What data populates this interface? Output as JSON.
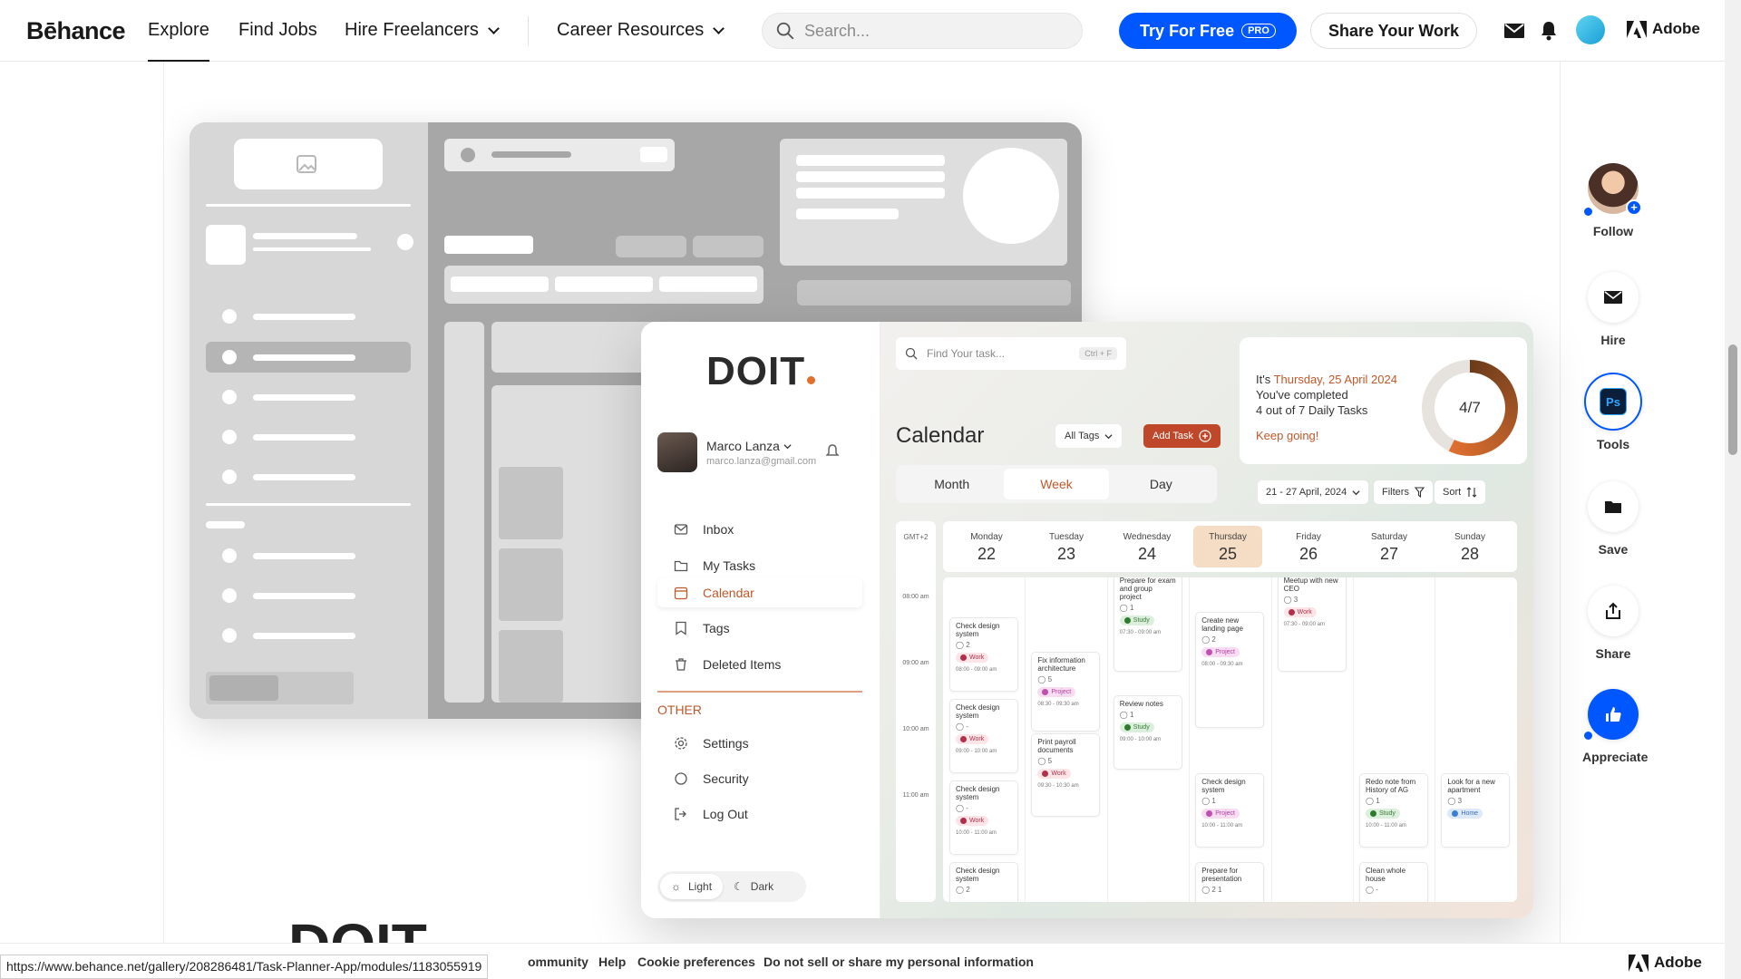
{
  "nav": {
    "logo": "Bēhance",
    "explore": "Explore",
    "find_jobs": "Find Jobs",
    "hire_freelancers": "Hire Freelancers",
    "career_resources": "Career Resources",
    "search_placeholder": "Search...",
    "try_free": "Try For Free",
    "pro_badge": "PRO",
    "share_work": "Share Your Work",
    "adobe": "Adobe"
  },
  "app": {
    "brand": "DOIT",
    "user_name": "Marco Lanza",
    "user_email": "marco.lanza@gmail.com",
    "menu": [
      "Inbox",
      "My Tasks",
      "Calendar",
      "Tags",
      "Deleted Items"
    ],
    "other_label": "OTHER",
    "other_menu": [
      "Settings",
      "Security",
      "Log Out"
    ],
    "theme_light": "Light",
    "theme_dark": "Dark",
    "search_placeholder": "Find Your task...",
    "search_shortcut": "Ctrl + F",
    "calendar_title": "Calendar",
    "all_tags": "All Tags",
    "add_task": "Add Task",
    "summary_prefix": "It's ",
    "summary_date": "Thursday, 25 April 2024",
    "summary_line2": "You've completed",
    "summary_line3": "4 out of 7 Daily Tasks",
    "keep_going": "Keep going!",
    "progress_label": "4/7",
    "progress_fraction": 0.571,
    "view_tabs": [
      "Month",
      "Week",
      "Day"
    ],
    "date_range": "21 - 27 April, 2024",
    "filters": "Filters",
    "sort": "Sort",
    "timezone": "GMT+2",
    "days": [
      {
        "name": "Monday",
        "num": "22"
      },
      {
        "name": "Tuesday",
        "num": "23"
      },
      {
        "name": "Wednesday",
        "num": "24"
      },
      {
        "name": "Thursday",
        "num": "25"
      },
      {
        "name": "Friday",
        "num": "26"
      },
      {
        "name": "Saturday",
        "num": "27"
      },
      {
        "name": "Sunday",
        "num": "28"
      }
    ],
    "times": [
      "08:00 am",
      "09:00 am",
      "10:00 am",
      "11:00 am"
    ],
    "events": [
      {
        "col": 0,
        "row": 0,
        "title": "Check design system",
        "meta": "2",
        "tag": "Work",
        "tagc": "tw",
        "time": "08:00 - 09:00 am"
      },
      {
        "col": 0,
        "row": 1,
        "title": "Check design system",
        "meta": "-",
        "tag": "Work",
        "tagc": "tw",
        "time": "09:00 - 10:00 am"
      },
      {
        "col": 0,
        "row": 2,
        "title": "Check design system",
        "meta": "-",
        "tag": "Work",
        "tagc": "tw",
        "time": "10:00 - 11:00 am"
      },
      {
        "col": 0,
        "row": 3,
        "title": "Check design system",
        "meta": "2",
        "tag": "",
        "tagc": "",
        "time": ""
      },
      {
        "col": 1,
        "row": 4,
        "title": "Fix information architecture",
        "meta": "5",
        "tag": "Project",
        "tagc": "tp",
        "time": "08:30 - 09:30 am"
      },
      {
        "col": 1,
        "row": 5,
        "title": "Print payroll documents",
        "meta": "5",
        "tag": "Work",
        "tagc": "tw",
        "time": "09:30 - 10:30 am"
      },
      {
        "col": 2,
        "row": 6,
        "title": "Prepare for exam and group project",
        "meta": "1",
        "tag": "Study",
        "tagc": "ts",
        "time": "07:30 - 09:00 am"
      },
      {
        "col": 2,
        "row": 7,
        "title": "Review notes",
        "meta": "1",
        "tag": "Study",
        "tagc": "ts",
        "time": "09:00 - 10:00 am"
      },
      {
        "col": 3,
        "row": 8,
        "title": "Create new landing page",
        "meta": "2",
        "tag": "Project",
        "tagc": "tp",
        "time": "08:00 - 09:30 am"
      },
      {
        "col": 3,
        "row": 9,
        "title": "Check design system",
        "meta": "1",
        "tag": "Project",
        "tagc": "tp",
        "time": "10:00 - 11:00 am"
      },
      {
        "col": 3,
        "row": 10,
        "title": "Prepare for presentation",
        "meta": "2  1",
        "tag": "",
        "tagc": "",
        "time": ""
      },
      {
        "col": 4,
        "row": 11,
        "title": "Meetup with new CEO",
        "meta": "3",
        "tag": "Work",
        "tagc": "tw",
        "time": "07:30 - 09:00 am"
      },
      {
        "col": 5,
        "row": 12,
        "title": "Redo note from History of AG",
        "meta": "1",
        "tag": "Study",
        "tagc": "ts",
        "time": "10:00 - 11:00 am"
      },
      {
        "col": 5,
        "row": 13,
        "title": "Clean whole house",
        "meta": "-",
        "tag": "",
        "tagc": "",
        "time": ""
      },
      {
        "col": 6,
        "row": 14,
        "title": "Look for a new apartment",
        "meta": "3",
        "tag": "Home",
        "tagc": "th",
        "time": ""
      }
    ]
  },
  "rail": {
    "follow": "Follow",
    "hire": "Hire",
    "tools": "Tools",
    "tools_badge": "Ps",
    "save": "Save",
    "share": "Share",
    "appreciate": "Appreciate"
  },
  "footer": {
    "community": "ommunity",
    "help": "Help",
    "cookies": "Cookie preferences",
    "do_not_sell": "Do not sell or share my personal information",
    "adobe": "Adobe",
    "status_url": "https://www.behance.net/gallery/208286481/Task-Planner-App/modules/1183055919",
    "big_title": "DOIT"
  },
  "colors": {
    "behance_blue": "#0057ff",
    "doit_accent": "#c0582a"
  }
}
